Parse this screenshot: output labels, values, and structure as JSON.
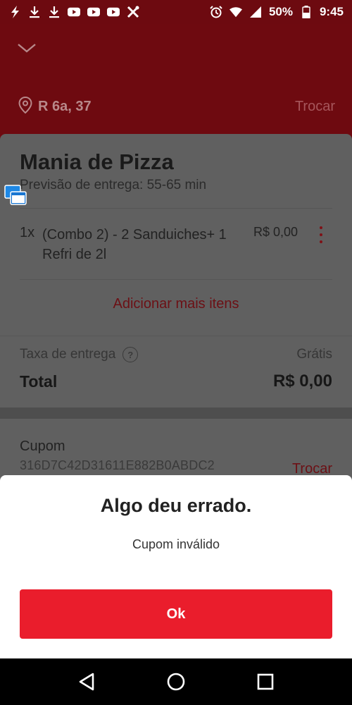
{
  "status_bar": {
    "battery_percent": "50%",
    "time": "9:45",
    "left_icons": [
      "flash-icon",
      "download-icon",
      "download-icon",
      "youtube-icon",
      "youtube-icon",
      "youtube-icon",
      "x-icon"
    ],
    "right_icons": [
      "alarm-icon",
      "wifi-icon",
      "signal-icon",
      "battery-icon"
    ]
  },
  "header": {
    "address": "R 6a, 37",
    "change_label": "Trocar"
  },
  "order": {
    "restaurant_name": "Mania de Pizza",
    "delivery_estimate": "Previsão de entrega: 55-65 min",
    "items": [
      {
        "qty": "1x",
        "name": "(Combo 2) - 2 Sanduiches+ 1 Refri de 2l",
        "price": "R$ 0,00"
      }
    ],
    "add_more_label": "Adicionar mais itens",
    "delivery_fee_label": "Taxa de entrega",
    "delivery_fee_value": "Grátis",
    "total_label": "Total",
    "total_value": "R$ 0,00"
  },
  "coupon": {
    "label": "Cupom",
    "code": "316D7C42D31611E882B0ABDC2",
    "change_label": "Trocar"
  },
  "dialog": {
    "title": "Algo deu errado.",
    "message": "Cupom inválido",
    "ok_label": "Ok"
  },
  "colors": {
    "brand_red": "#ea1d2c",
    "header_bg": "#6e0a10",
    "overlay_card": "#606060"
  }
}
